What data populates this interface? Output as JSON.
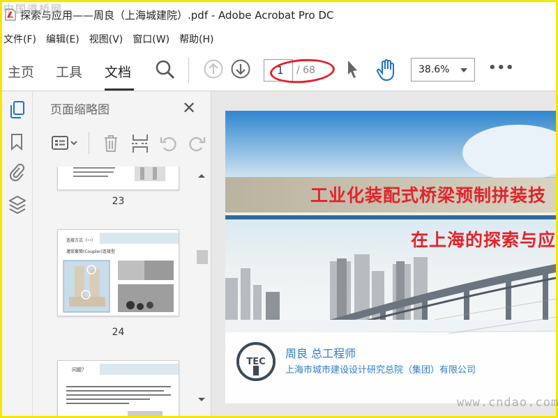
{
  "window": {
    "title": "探索与应用——周良（上海城建院）.pdf - Adobe Acrobat Pro DC",
    "watermark_top": "中国道桥网",
    "watermark_bottom": "www.cndao.com"
  },
  "menu": [
    "文件(F)",
    "编辑(E)",
    "视图(V)",
    "窗口(W)",
    "帮助(H)"
  ],
  "tabs": [
    {
      "label": "主页",
      "active": false
    },
    {
      "label": "工具",
      "active": false
    },
    {
      "label": "文档",
      "active": true
    }
  ],
  "toolbar": {
    "current_page": "1",
    "page_total": "/ 68",
    "zoom": "38.6%",
    "more": "•••"
  },
  "thumbnail_pane": {
    "title": "页面缩略图",
    "thumbnails": [
      {
        "page": "23",
        "heading": ""
      },
      {
        "page": "24",
        "heading": "连接方式（一）",
        "subheading": "灌浆套筒(Coupler)连接型"
      },
      {
        "page": "",
        "heading": "问题？"
      }
    ]
  },
  "slide": {
    "title_line1": "工业化装配式桥梁预制拼装技",
    "title_line2": "在上海的探索与应",
    "author": "周良  总工程师",
    "organization": "上海市城市建设设计研究总院（集团）有限公司",
    "logo_text": "TEC"
  },
  "colors": {
    "accent_red": "#e4232b",
    "link_blue": "#2a7fc9",
    "highlight_yellow": "#f6e600"
  }
}
